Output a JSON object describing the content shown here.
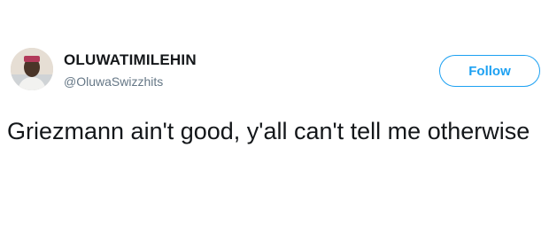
{
  "tweet": {
    "author": {
      "display_name": "OLUWATIMILEHIN",
      "handle": "@OluwaSwizzhits",
      "avatar_icon": "user-avatar"
    },
    "follow_button": {
      "label": "Follow",
      "color": "#1da1f2"
    },
    "text": "Griezmann ain't good, y'all can't tell me otherwise"
  }
}
